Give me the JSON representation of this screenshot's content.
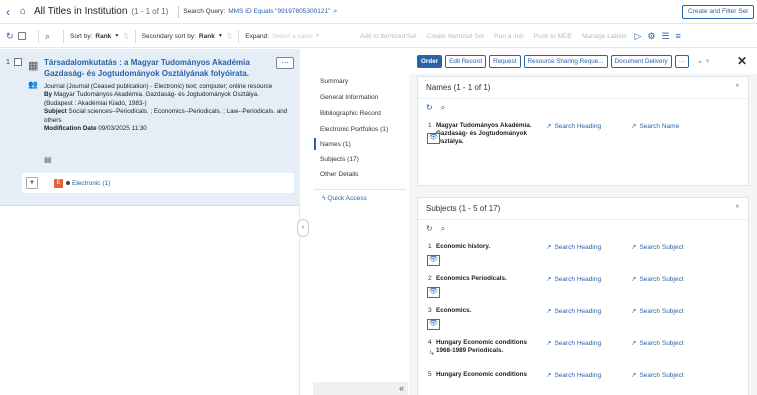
{
  "topbar": {
    "back_icon": "chevron-left-icon",
    "home_icon": "home-icon",
    "title": "All Titles in Institution",
    "count": "(1 - 1 of 1)",
    "query_label": "Search Query:",
    "query_value": "MMS ID Equals \"99197805300121\"",
    "create_button": "Create and Filter Set"
  },
  "toolbar": {
    "sort_label": "Sort by:",
    "sort_value": "Rank",
    "secondary_label": "Secondary sort by:",
    "secondary_value": "Rank",
    "expand_label": "Expand:",
    "expand_placeholder": "Select a value",
    "add_itemized": "Add to Itemized Set",
    "create_itemized": "Create Itemized Set",
    "run_job": "Run a Job",
    "push_mde": "Push to MDE",
    "manage_labels": "Manage Labels"
  },
  "record": {
    "number": "1",
    "title": "Társadalomkutatás : a Magyar Tudományos Akadémia Gazdaság- és Jogtudományok Osztályának folyóirata.",
    "type": "Journal (Journal (Ceased publication) - Electronic) text; computer; online resource",
    "by_label": "By",
    "by_value": "Magyar Tudományos Akadémia. Gazdaság- és Jogtudományok Osztálya. (Budapest : Akadémiai Kiadó, 1983-)",
    "subject_label": "Subject",
    "subject_value": "Social sciences--Periodicals. ; Economics--Periodicals. ; Law--Periodicals. and others",
    "modified_label": "Modification Date",
    "modified_value": "09/03/2025 11:30",
    "avail_badge": "E",
    "avail_link": "Electronic (1)"
  },
  "nav": {
    "items": [
      "Summary",
      "General Information",
      "Bibliographic Record",
      "Electronic Portfolios (1)",
      "Names (1)",
      "Subjects (17)",
      "Other Details"
    ],
    "quick_access": "Quick Access",
    "collapse": "«"
  },
  "actions": {
    "order": "Order",
    "edit": "Edit Record",
    "request": "Request",
    "resource_sharing": "Resource Sharing Reque...",
    "document_delivery": "Document Delivery",
    "more": "···"
  },
  "names": {
    "header": "Names (1 - 1 of 1)",
    "rows": [
      {
        "num": "1",
        "text": "Magyar Tudományos Akadémia. Gazdaság- és Jogtudományok Osztálya.",
        "link1": "Search Heading",
        "link2": "Search Name"
      }
    ]
  },
  "subjects": {
    "header": "Subjects (1 - 5 of 17)",
    "rows": [
      {
        "num": "1",
        "text": "Economic history.",
        "link1": "Search Heading",
        "link2": "Search Subject"
      },
      {
        "num": "2",
        "text": "Economics Periodicals.",
        "link1": "Search Heading",
        "link2": "Search Subject"
      },
      {
        "num": "3",
        "text": "Economics.",
        "link1": "Search Heading",
        "link2": "Search Subject"
      },
      {
        "num": "4",
        "text": "Hungary Economic conditions 1968-1989 Periodicals.",
        "link1": "Search Heading",
        "link2": "Search Subject"
      },
      {
        "num": "5",
        "text": "Hungary Economic conditions",
        "link1": "Search Heading",
        "link2": "Search Subject"
      }
    ]
  },
  "colors": {
    "accent": "#2a62a8",
    "record_bg": "#e5eef7",
    "highlight": "#dd3333",
    "electronic_badge": "#e0623e"
  }
}
